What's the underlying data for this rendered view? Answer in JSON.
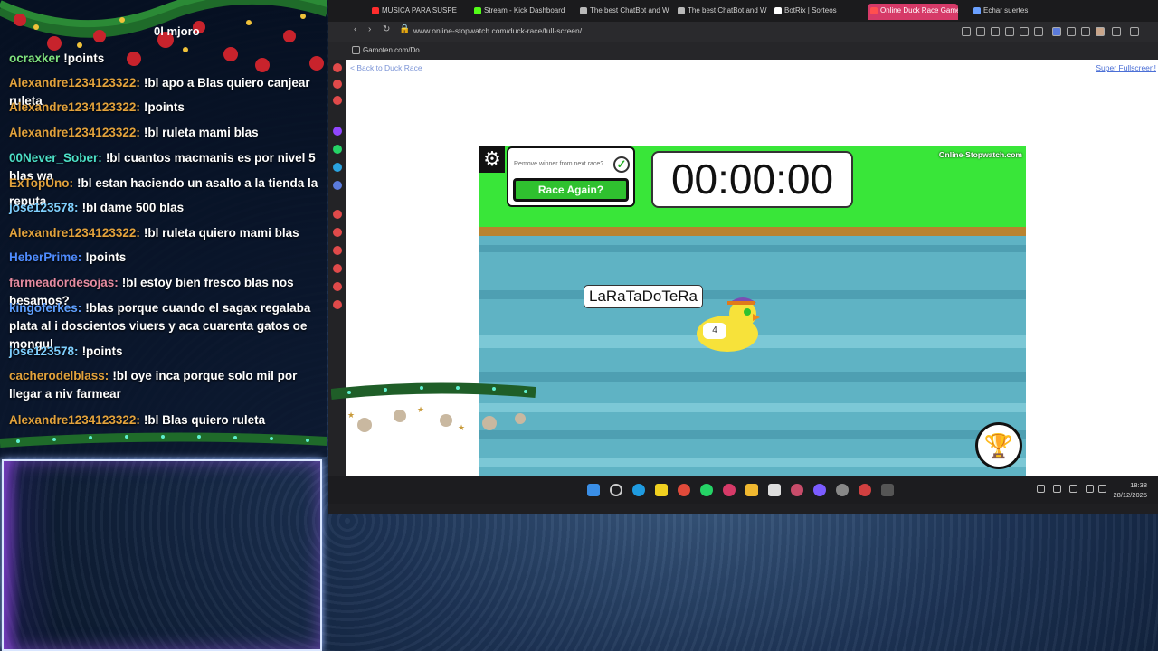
{
  "chat": {
    "top_label": "0l mjoro",
    "messages": [
      {
        "user": "ocraxker",
        "color": "#7fe27f",
        "text": "!points"
      },
      {
        "user": "Alexandre1234123322:",
        "color": "#e2a23c",
        "text": "!bl apo a Blas quiero canjear ruleta"
      },
      {
        "user": "Alexandre1234123322:",
        "color": "#e2a23c",
        "text": "!points"
      },
      {
        "user": "Alexandre1234123322:",
        "color": "#e2a23c",
        "text": "!bl ruleta mami blas"
      },
      {
        "user": "00Never_Sober:",
        "color": "#4ce0c8",
        "text": "!bl cuantos macmanis es por nivel 5 blas wa"
      },
      {
        "user": "ExTopUno:",
        "color": "#e2a23c",
        "text": "!bl estan haciendo un asalto a la tienda la reputa"
      },
      {
        "user": "jose123578:",
        "color": "#7fd0ff",
        "text": "!bl dame 500 blas"
      },
      {
        "user": "Alexandre1234123322:",
        "color": "#e2a23c",
        "text": "!bl ruleta quiero mami blas"
      },
      {
        "user": "HeberPrime:",
        "color": "#4f8cff",
        "text": "!points"
      },
      {
        "user": "farmeadordesojas:",
        "color": "#e58ba0",
        "text": "!bl estoy bien fresco blas nos besamos?"
      },
      {
        "user": "kingoferkes:",
        "color": "#5fa0ff",
        "text": "!blas porque cuando el sagax regalaba plata al i doscientos viuers y aca cuarenta gatos oe mongul"
      },
      {
        "user": "jose123578:",
        "color": "#7fd0ff",
        "text": "!points"
      },
      {
        "user": "cacherodelblass:",
        "color": "#e2a23c",
        "text": "!bl oye inca porque solo mil por llegar a niv farmear"
      },
      {
        "user": "Alexandre1234123322:",
        "color": "#e2a23c",
        "text": "!bl Blas quiero ruleta"
      }
    ]
  },
  "browser": {
    "tabs": [
      {
        "label": "MUSICA PARA SUSPE",
        "favicon_color": "#ff2d2d"
      },
      {
        "label": "Stream - Kick Dashboard",
        "favicon_color": "#53fc18"
      },
      {
        "label": "The best ChatBot and Wi",
        "favicon_color": "#b9b9b9"
      },
      {
        "label": "The best ChatBot and Wi",
        "favicon_color": "#b9b9b9"
      },
      {
        "label": "BotRix | Sorteos",
        "favicon_color": "#ffffff"
      },
      {
        "label": "Online Duck Race Game",
        "favicon_color": "#ff4f4f"
      },
      {
        "label": "Echar suertes",
        "favicon_color": "#6aa0ff"
      }
    ],
    "url": "www.online-stopwatch.com/duck-race/full-screen/",
    "bookmark": "Gamoten.com/Do..."
  },
  "page": {
    "back_link": "< Back to Duck Race",
    "fullscreen_link": "Super Fullscreen!"
  },
  "game": {
    "remove_winner_label": "Remove winner from next race?",
    "remove_winner_checked": true,
    "race_again_label": "Race Again?",
    "timer": "00:00:00",
    "brand": "Online-Stopwatch.com",
    "duck_name": "LaRaTaDoTeRa",
    "duck_number": "4",
    "colors": {
      "grass": "#39e639",
      "water": "#5fb3c4",
      "button": "#2fc12f"
    }
  },
  "taskbar": {
    "time": "18:38",
    "date": "28/12/2025"
  }
}
